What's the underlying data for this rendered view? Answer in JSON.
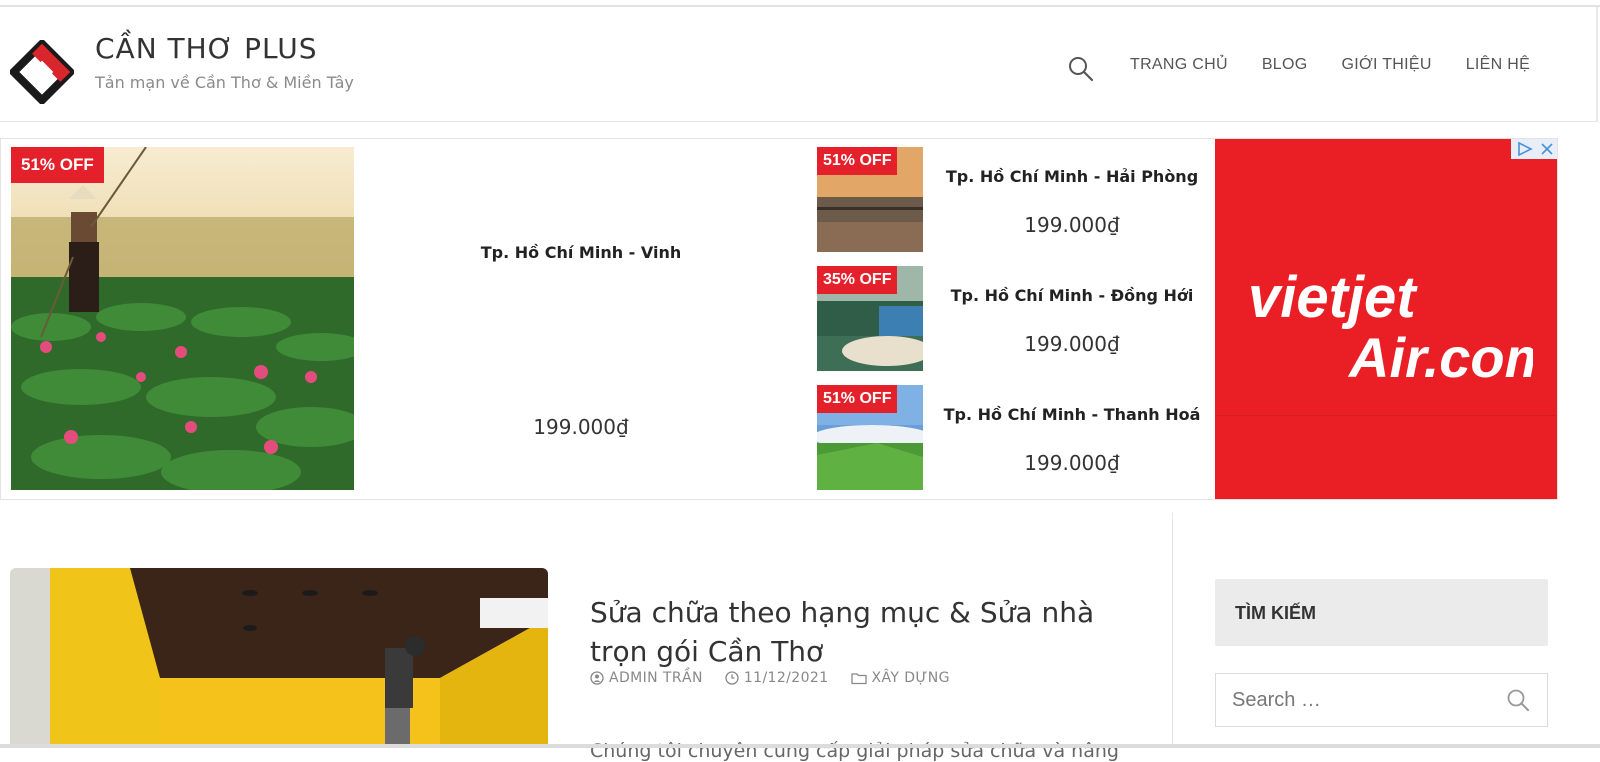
{
  "site": {
    "title": "CẦN THƠ PLUS",
    "tagline": "Tản mạn về Cần Thơ & Miền Tây"
  },
  "nav": {
    "items": [
      "TRANG CHỦ",
      "BLOG",
      "GIỚI THIỆU",
      "LIÊN HỆ"
    ]
  },
  "ad": {
    "featured": {
      "badge": "51% OFF",
      "route": "Tp. Hồ Chí Minh - Vinh",
      "price": "199.000₫"
    },
    "deals": [
      {
        "badge": "51% OFF",
        "route": "Tp. Hồ Chí Minh - Hải Phòng",
        "price": "199.000₫"
      },
      {
        "badge": "35% OFF",
        "route": "Tp. Hồ Chí Minh - Đồng Hới",
        "price": "199.000₫"
      },
      {
        "badge": "51% OFF",
        "route": "Tp. Hồ Chí Minh - Thanh Hoá",
        "price": "199.000₫"
      }
    ],
    "brand": {
      "line1": "vietjet",
      "line2": "Air.com",
      "color": "#ea1f26"
    }
  },
  "post": {
    "title": "Sửa chữa theo hạng mục & Sửa nhà trọn gói Cần Thơ",
    "author": "ADMIN TRẦN",
    "date": "11/12/2021",
    "category": "XÂY DỰNG",
    "excerpt": "Chúng tôi chuyên cung cấp giải pháp sửa chữa và nâng"
  },
  "sidebar": {
    "widget_title": "TÌM KIẾM",
    "search_placeholder": "Search …"
  },
  "colors": {
    "accent_red": "#e4202a",
    "text": "#333333",
    "muted": "#888888"
  }
}
